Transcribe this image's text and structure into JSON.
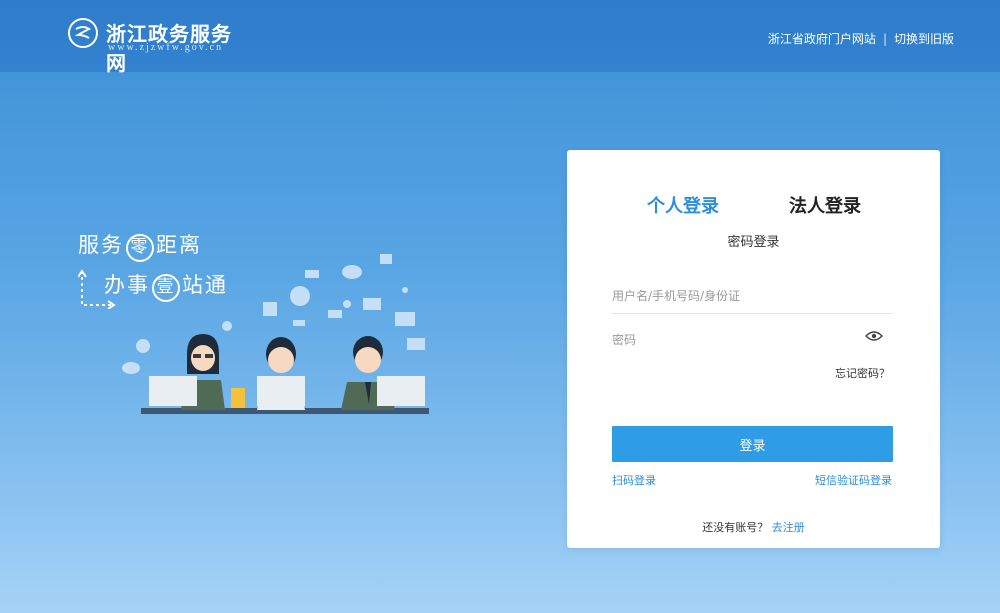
{
  "header": {
    "logo_title": "浙江政务服务网",
    "logo_url": "www.zjzwfw.gov.cn",
    "links": [
      {
        "label": "浙江省政府门户网站"
      },
      {
        "label": "切换到旧版"
      }
    ],
    "separator": "|"
  },
  "slogan": {
    "line1_a": "服务",
    "line1_circle": "零",
    "line1_b": "距离",
    "line2_a": "办事",
    "line2_circle": "壹",
    "line2_b": "站通"
  },
  "login": {
    "tabs": [
      {
        "label": "个人登录",
        "active": true
      },
      {
        "label": "法人登录",
        "active": false
      }
    ],
    "subtitle": "密码登录",
    "username_placeholder": "用户名/手机号码/身份证",
    "password_placeholder": "密码",
    "forgot_label": "忘记密码？",
    "submit_label": "登录",
    "scan_login_label": "扫码登录",
    "sms_login_label": "短信验证码登录",
    "register_prompt": "还没有账号？",
    "register_link": "去注册"
  },
  "colors": {
    "header_bg": "#3382cf",
    "accent": "#2f8ddd",
    "button": "#2f9de6"
  }
}
